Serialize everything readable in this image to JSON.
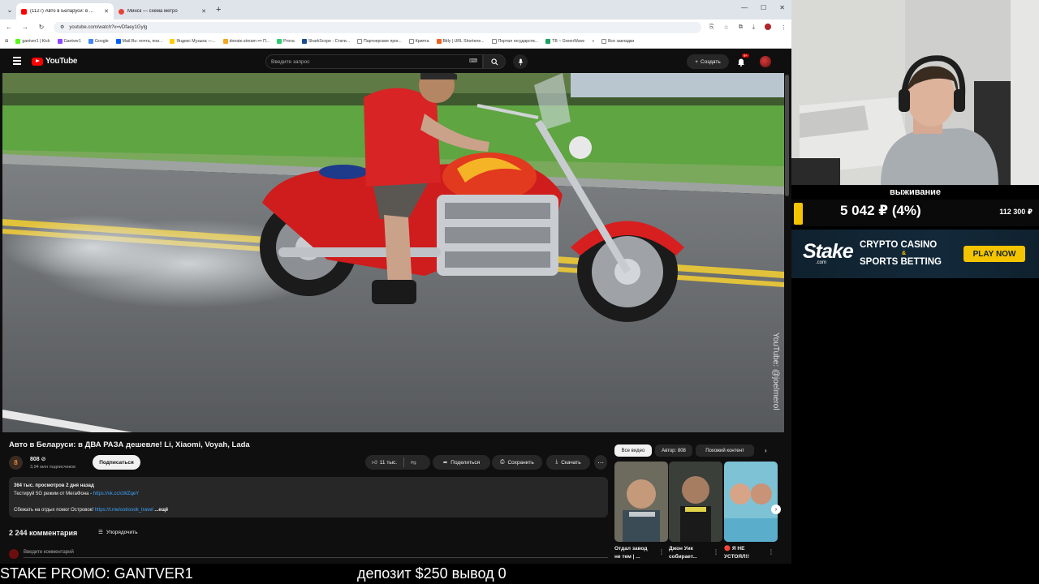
{
  "browser": {
    "tabs": [
      {
        "title": "(1127) Авто в Беларуси: в ...",
        "active": true,
        "favicon_color": "#ff0000"
      },
      {
        "title": "Минск — схема метро",
        "active": false,
        "favicon_color": "#ea4335"
      }
    ],
    "url": "youtube.com/watch?v=vDfaey1Gylg",
    "bookmarks": [
      {
        "label": "gantver1 | Kick",
        "color": "#53fc18"
      },
      {
        "label": "Gantver1",
        "color": "#9146ff"
      },
      {
        "label": "Google",
        "color": "#4285f4"
      },
      {
        "label": "Mail.Ru: почта, пои...",
        "color": "#005ff9"
      },
      {
        "label": "Яндекс Музыка —...",
        "color": "#ffcc00"
      },
      {
        "label": "donate.stream ••• П...",
        "color": "#f5a623"
      },
      {
        "label": "Prova",
        "color": "#2ecc71"
      },
      {
        "label": "SharkScope - Стати...",
        "color": "#1a4d8f"
      },
      {
        "label": "Партнерские прог...",
        "color": "#888888"
      },
      {
        "label": "Крипта",
        "color": "#888888"
      },
      {
        "label": "Bitly | URL Shortene...",
        "color": "#ee6123"
      },
      {
        "label": "Портал государств...",
        "color": "#0d4cd3"
      },
      {
        "label": "TB ~ GreenWave",
        "color": "#1aa260"
      }
    ],
    "all_bookmarks": "Все закладки"
  },
  "youtube": {
    "logo": "YouTube",
    "search_placeholder": "Введите запрос",
    "create_label": "Создать",
    "notifications_badge": "9+",
    "watermark": "YouTube: @joelmerol",
    "video_title": "Авто в Беларуси: в ДВА РАЗА дешевле! Li, Xiaomi, Voyah, Lada",
    "channel": {
      "name": "808 ⊘",
      "subs": "3,94 млн подписчиков",
      "avatar_text": "8"
    },
    "subscribe_label": "Подписаться",
    "likes": "11 тыс.",
    "share_label": "Поделиться",
    "save_label": "Сохранить",
    "download_label": "Скачать",
    "description": {
      "stats": "364 тыс. просмотров  2 дня назад",
      "line1": "Тестируй 5G режим от МегаФона - ",
      "line1_link": "https://vk.cc/cWZqeY",
      "line2": "Сбежать на отдых помог Островок! ",
      "line2_link": "https://t.me/ostrovok_travel",
      "more": "...ещё"
    },
    "comments_count": "2 244 комментария",
    "sort_label": "Упорядочить",
    "comment_placeholder": "Введите комментарий",
    "chips": [
      "Все видео",
      "Автор: 808",
      "Похожий контент"
    ],
    "recommended": [
      {
        "caption1": "Отдал завод",
        "caption2": "не тем | ..."
      },
      {
        "caption1": "Джон Уик",
        "caption2": "собирает..."
      },
      {
        "caption1": "🔴 Я НЕ",
        "caption2": "УСТОЯЛ!!"
      }
    ]
  },
  "stream": {
    "stat_title": "выживание",
    "stat_value": "5 042 ₽ (4%)",
    "stat_goal": "112 300 ₽",
    "stat_progress_percent": 4,
    "stake": {
      "logo": "Stake",
      "logo_sub": ".com",
      "line1": "CRYPTO CASINO",
      "amp": "&",
      "line2": "SPORTS BETTING",
      "cta": "PLAY NOW"
    },
    "ticker_left": "STAKE PROMO: GANTVER1",
    "ticker_right": "депозит $250 вывод 0"
  }
}
